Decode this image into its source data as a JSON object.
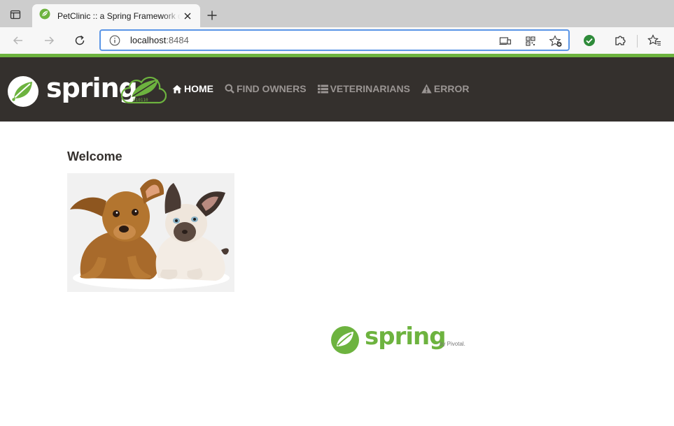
{
  "browser": {
    "tab_title": "PetClinic :: a Spring Framework demonstration",
    "url_host": "localhost",
    "url_port": ":8484",
    "icons": [
      "tab-actions-icon",
      "spring-favicon-icon",
      "close-icon",
      "new-tab-icon",
      "back-icon",
      "forward-icon",
      "reload-icon",
      "info-icon",
      "cast-icon",
      "qr-code-icon",
      "favorite-add-icon",
      "verified-extension-icon",
      "extensions-icon",
      "favorites-icon"
    ]
  },
  "navbar": {
    "brand": "spring",
    "cloud_digits": "010110",
    "items": [
      {
        "label": "Home",
        "icon": "home-icon",
        "active": true
      },
      {
        "label": "Find owners",
        "icon": "search-icon",
        "active": false
      },
      {
        "label": "Veterinarians",
        "icon": "list-icon",
        "active": false
      },
      {
        "label": "Error",
        "icon": "warning-icon",
        "active": false
      }
    ]
  },
  "main": {
    "heading": "Welcome",
    "image_alt": "pets"
  },
  "footer": {
    "brand": "spring",
    "byline": "by Pivotal."
  },
  "colors": {
    "spring_green": "#6db33f",
    "navbar_bg": "#34302d",
    "nav_inactive": "#9a9593"
  }
}
